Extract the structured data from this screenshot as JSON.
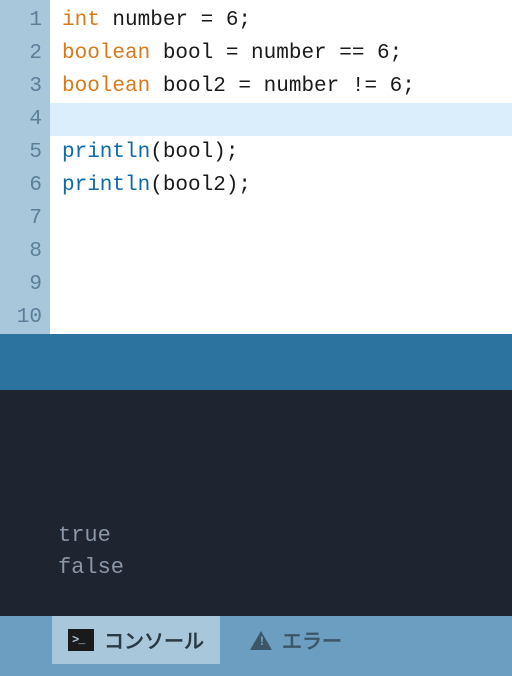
{
  "editor": {
    "lines": [
      {
        "num": "1",
        "tokens": [
          {
            "t": "int",
            "c": "kw-type"
          },
          {
            "t": " number = 6;",
            "c": ""
          }
        ]
      },
      {
        "num": "2",
        "tokens": [
          {
            "t": "boolean",
            "c": "kw-type"
          },
          {
            "t": " bool = number == 6;",
            "c": ""
          }
        ]
      },
      {
        "num": "3",
        "tokens": [
          {
            "t": "boolean",
            "c": "kw-type"
          },
          {
            "t": " bool2 = number != 6;",
            "c": ""
          }
        ]
      },
      {
        "num": "4",
        "tokens": []
      },
      {
        "num": "5",
        "tokens": [
          {
            "t": "println",
            "c": "kw-fn"
          },
          {
            "t": "(bool);",
            "c": ""
          }
        ]
      },
      {
        "num": "6",
        "tokens": [
          {
            "t": "println",
            "c": "kw-fn"
          },
          {
            "t": "(bool2);",
            "c": ""
          }
        ]
      },
      {
        "num": "7",
        "tokens": []
      },
      {
        "num": "8",
        "tokens": []
      },
      {
        "num": "9",
        "tokens": []
      },
      {
        "num": "10",
        "tokens": []
      }
    ],
    "current_line_index": 3
  },
  "console": {
    "output": [
      "true",
      "false"
    ]
  },
  "tabs": {
    "console_label": "コンソール",
    "errors_label": "エラー"
  }
}
